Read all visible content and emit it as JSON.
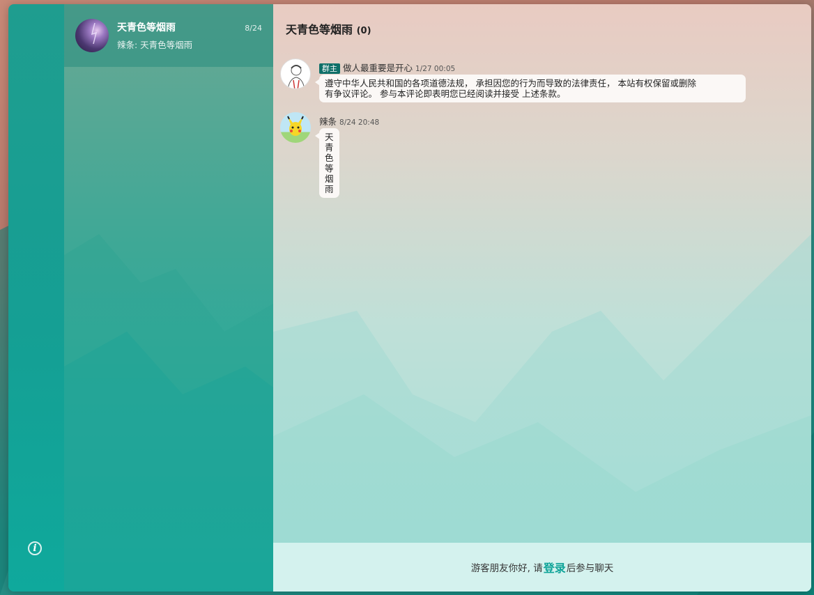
{
  "conversation": {
    "title": "天青色等烟雨",
    "date": "8/24",
    "preview": "辣条: 天青色等烟雨"
  },
  "chat": {
    "title": "天青色等烟雨",
    "count": "(0)",
    "messages": [
      {
        "badge": "群主",
        "user": "做人最重要是开心",
        "time": "1/27 00:05",
        "text_line1": "遵守中华人民共和国的各项道德法规， 承担因您的行为而导致的法律责任， 本站有权保留或删除",
        "text_line2": "有争议评论。 参与本评论即表明您已经阅读并接受 上述条款。"
      },
      {
        "user": "辣条",
        "time": "8/24 20:48",
        "text": "天青色等烟雨"
      }
    ]
  },
  "footer": {
    "prefix": "游客朋友你好, 请",
    "login": "登录",
    "suffix": "后参与聊天"
  },
  "icons": {
    "info": "info-icon"
  },
  "colors": {
    "accent": "#0ea398",
    "badge": "#0e6f68"
  }
}
